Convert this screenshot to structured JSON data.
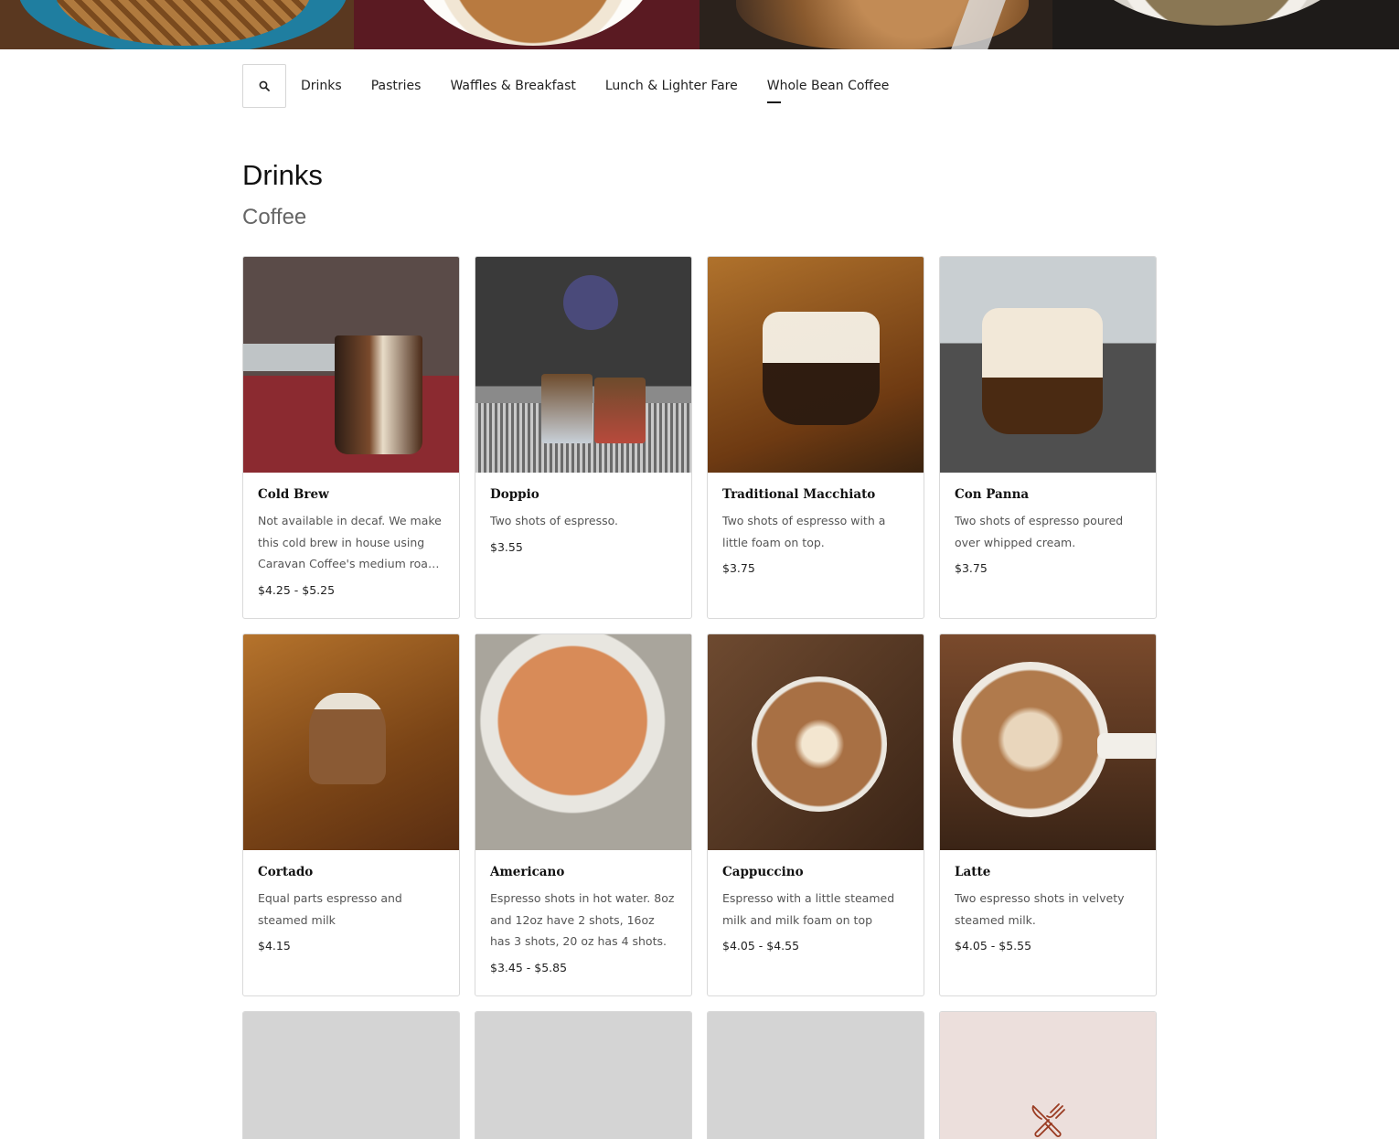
{
  "hero": {
    "images": [
      "waffle-photo",
      "latte-art-photo",
      "blueberry-muffin-photo",
      "black-coffee-photo"
    ]
  },
  "nav": {
    "search_icon": "search-icon",
    "items": [
      {
        "label": "Drinks",
        "active": false
      },
      {
        "label": "Pastries",
        "active": false
      },
      {
        "label": "Waffles & Breakfast",
        "active": false
      },
      {
        "label": "Lunch & Lighter Fare",
        "active": false
      },
      {
        "label": "Whole Bean Coffee",
        "active": true
      }
    ]
  },
  "section": {
    "title": "Drinks",
    "subtitle": "Coffee"
  },
  "items": [
    {
      "name": "Cold Brew",
      "description": "Not available in decaf. We make this cold brew in house using Caravan Coffee's medium roast blend.",
      "price": "$4.25 - $5.25"
    },
    {
      "name": "Doppio",
      "description": "Two shots of espresso.",
      "price": "$3.55"
    },
    {
      "name": "Traditional Macchiato",
      "description": "Two shots of espresso with a little foam on top.",
      "price": "$3.75"
    },
    {
      "name": "Con Panna",
      "description": "Two shots of espresso poured over whipped cream.",
      "price": "$3.75"
    },
    {
      "name": "Cortado",
      "description": "Equal parts espresso and steamed milk",
      "price": "$4.15"
    },
    {
      "name": "Americano",
      "description": "Espresso shots in hot water. 8oz and 12oz have 2 shots, 16oz has 3 shots, 20 oz has 4 shots.",
      "price": "$3.45 - $5.85"
    },
    {
      "name": "Cappuccino",
      "description": "Espresso with a little steamed milk and milk foam on top",
      "price": "$4.05 - $4.55"
    },
    {
      "name": "Latte",
      "description": "Two espresso shots in velvety steamed milk.",
      "price": "$4.05 - $5.55"
    }
  ],
  "placeholders": {
    "brand_icon": "fork-knife-icon",
    "brand_color": "#9a3b22",
    "brand_bg": "#ecdfdc",
    "loading_bg": "#d4d4d4"
  }
}
